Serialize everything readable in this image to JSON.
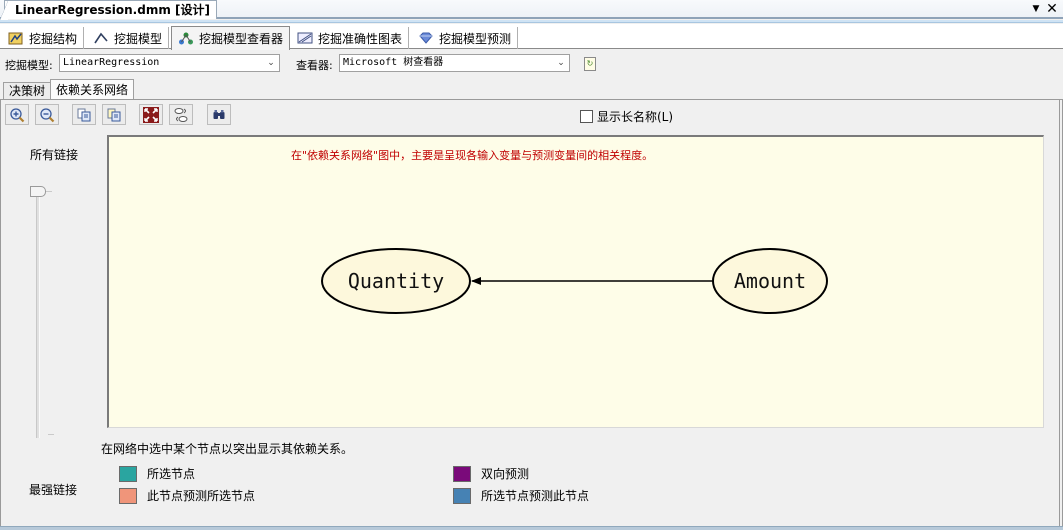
{
  "document_tab": {
    "title": "LinearRegression.dmm [设计]",
    "menu_icon": "dropdown-arrow-icon",
    "close_icon": "close-icon"
  },
  "designer_tabs": [
    {
      "label": "挖掘结构",
      "icon": "mining-structure-icon",
      "active": false
    },
    {
      "label": "挖掘模型",
      "icon": "mining-model-icon",
      "active": false
    },
    {
      "label": "挖掘模型查看器",
      "icon": "model-viewer-icon",
      "active": true
    },
    {
      "label": "挖掘准确性图表",
      "icon": "accuracy-chart-icon",
      "active": false
    },
    {
      "label": "挖掘模型预测",
      "icon": "prediction-icon",
      "active": false
    }
  ],
  "selectors": {
    "model_label": "挖掘模型:",
    "model_value": "LinearRegression",
    "viewer_label": "查看器:",
    "viewer_value": "Microsoft 树查看器"
  },
  "sub_tabs": [
    {
      "label": "决策树",
      "active": false
    },
    {
      "label": "依赖关系网络",
      "active": true
    }
  ],
  "toolbar": {
    "buttons": [
      "zoom-in",
      "zoom-out",
      "copy-graph-view",
      "copy-entire-graph",
      "fit-to-window",
      "layout",
      "find-node"
    ]
  },
  "show_long_name": {
    "label": "显示长名称(L)",
    "checked": false
  },
  "slider": {
    "top_label": "所有链接",
    "bottom_label": "最强链接",
    "position_fraction": 0.0
  },
  "canvas": {
    "note": "在\"依赖关系网络\"图中，主要是呈现各输入变量与预测变量间的相关程度。",
    "nodes": [
      {
        "id": "quantity",
        "label": "Quantity"
      },
      {
        "id": "amount",
        "label": "Amount"
      }
    ],
    "edges": [
      {
        "from": "amount",
        "to": "quantity"
      }
    ]
  },
  "hint": "在网络中选中某个节点以突出显示其依赖关系。",
  "legend": [
    {
      "label": "所选节点",
      "color": "#2aa5a0"
    },
    {
      "label": "此节点预测所选节点",
      "color": "#f0957a"
    },
    {
      "label": "双向预测",
      "color": "#7a0a7a"
    },
    {
      "label": "所选节点预测此节点",
      "color": "#4682b4"
    }
  ],
  "colors": {
    "canvas_bg": "#fefde8",
    "node_fill": "#fdf8dc",
    "note_text": "#c00000"
  }
}
